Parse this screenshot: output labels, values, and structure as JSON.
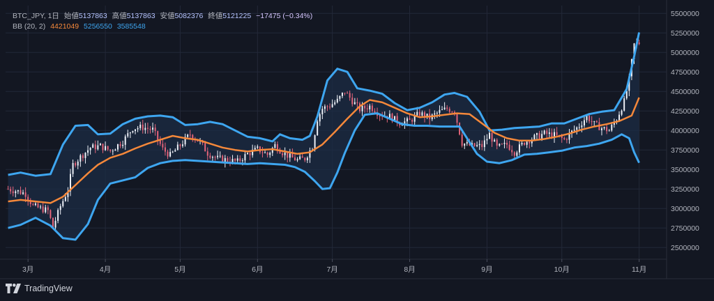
{
  "legend": {
    "symbol": "BTC_JPY, 1日",
    "open_label": "始値",
    "open": "5137863",
    "high_label": "高値",
    "high": "5137863",
    "low_label": "安値",
    "low": "5082376",
    "close_label": "終値",
    "close": "5121225",
    "change": "−17475 (−0.34%)",
    "bb_label": "BB (20, 2)",
    "bb_mid": "4421049",
    "bb_upper": "5256550",
    "bb_lower": "3585548"
  },
  "brand": {
    "text": "TradingView",
    "icon": "tradingview-logo-icon"
  },
  "colors": {
    "background": "#131722",
    "grid": "#232838",
    "band_fill": "#1c2c44",
    "upper_band": "#3ea6f0",
    "lower_band": "#3ea6f0",
    "middle_band": "#f5883a",
    "candle_up": "#f0f3fa",
    "candle_down": "#e8657b",
    "axis_text": "#b2b5be"
  },
  "chart_data": {
    "type": "candlestick",
    "xlabel": "",
    "ylabel": "",
    "x_ticks": [
      "3月",
      "4月",
      "5月",
      "6月",
      "7月",
      "8月",
      "9月",
      "10月",
      "11月"
    ],
    "y_ticks": [
      "2500000",
      "2750000",
      "3000000",
      "3250000",
      "3500000",
      "3750000",
      "4000000",
      "4250000",
      "4500000",
      "4750000",
      "5000000",
      "5250000",
      "5500000"
    ],
    "ylim": [
      2350000,
      5600000
    ],
    "x_range": [
      "2023-02-20",
      "2023-11-12"
    ],
    "grid": true,
    "upper_band": [
      [
        "2023-02-21",
        3430000
      ],
      [
        "2023-02-26",
        3460000
      ],
      [
        "2023-03-04",
        3420000
      ],
      [
        "2023-03-10",
        3440000
      ],
      [
        "2023-03-15",
        3820000
      ],
      [
        "2023-03-20",
        4060000
      ],
      [
        "2023-03-25",
        4070000
      ],
      [
        "2023-03-29",
        3950000
      ],
      [
        "2023-04-03",
        3960000
      ],
      [
        "2023-04-08",
        4080000
      ],
      [
        "2023-04-13",
        4150000
      ],
      [
        "2023-04-18",
        4180000
      ],
      [
        "2023-04-23",
        4190000
      ],
      [
        "2023-04-28",
        4170000
      ],
      [
        "2023-05-03",
        4070000
      ],
      [
        "2023-05-08",
        4080000
      ],
      [
        "2023-05-13",
        4110000
      ],
      [
        "2023-05-18",
        4080000
      ],
      [
        "2023-05-23",
        4000000
      ],
      [
        "2023-05-28",
        3920000
      ],
      [
        "2023-06-02",
        3900000
      ],
      [
        "2023-06-07",
        3860000
      ],
      [
        "2023-06-10",
        3950000
      ],
      [
        "2023-06-14",
        3900000
      ],
      [
        "2023-06-19",
        3880000
      ],
      [
        "2023-06-22",
        3930000
      ],
      [
        "2023-06-25",
        4180000
      ],
      [
        "2023-06-29",
        4640000
      ],
      [
        "2023-07-03",
        4790000
      ],
      [
        "2023-07-07",
        4750000
      ],
      [
        "2023-07-11",
        4540000
      ],
      [
        "2023-07-16",
        4510000
      ],
      [
        "2023-07-21",
        4470000
      ],
      [
        "2023-07-26",
        4350000
      ],
      [
        "2023-07-31",
        4260000
      ],
      [
        "2023-08-05",
        4290000
      ],
      [
        "2023-08-10",
        4360000
      ],
      [
        "2023-08-15",
        4460000
      ],
      [
        "2023-08-19",
        4480000
      ],
      [
        "2023-08-24",
        4430000
      ],
      [
        "2023-08-29",
        4240000
      ],
      [
        "2023-09-02",
        4000000
      ],
      [
        "2023-09-07",
        4010000
      ],
      [
        "2023-09-12",
        4030000
      ],
      [
        "2023-09-17",
        4040000
      ],
      [
        "2023-09-22",
        4050000
      ],
      [
        "2023-09-27",
        4090000
      ],
      [
        "2023-10-02",
        4090000
      ],
      [
        "2023-10-07",
        4150000
      ],
      [
        "2023-10-12",
        4210000
      ],
      [
        "2023-10-17",
        4240000
      ],
      [
        "2023-10-22",
        4260000
      ],
      [
        "2023-10-27",
        4530000
      ],
      [
        "2023-10-30",
        4950000
      ],
      [
        "2023-11-01",
        5256550
      ]
    ],
    "middle_band": [
      [
        "2023-02-21",
        3090000
      ],
      [
        "2023-02-26",
        3110000
      ],
      [
        "2023-03-04",
        3090000
      ],
      [
        "2023-03-10",
        3070000
      ],
      [
        "2023-03-15",
        3150000
      ],
      [
        "2023-03-20",
        3300000
      ],
      [
        "2023-03-25",
        3450000
      ],
      [
        "2023-03-29",
        3560000
      ],
      [
        "2023-04-03",
        3650000
      ],
      [
        "2023-04-08",
        3700000
      ],
      [
        "2023-04-13",
        3770000
      ],
      [
        "2023-04-18",
        3830000
      ],
      [
        "2023-04-23",
        3880000
      ],
      [
        "2023-04-28",
        3930000
      ],
      [
        "2023-05-03",
        3900000
      ],
      [
        "2023-05-08",
        3880000
      ],
      [
        "2023-05-13",
        3830000
      ],
      [
        "2023-05-18",
        3780000
      ],
      [
        "2023-05-23",
        3750000
      ],
      [
        "2023-05-28",
        3730000
      ],
      [
        "2023-06-02",
        3750000
      ],
      [
        "2023-06-07",
        3760000
      ],
      [
        "2023-06-12",
        3730000
      ],
      [
        "2023-06-17",
        3700000
      ],
      [
        "2023-06-22",
        3720000
      ],
      [
        "2023-06-27",
        3820000
      ],
      [
        "2023-07-02",
        3980000
      ],
      [
        "2023-07-07",
        4150000
      ],
      [
        "2023-07-12",
        4310000
      ],
      [
        "2023-07-16",
        4390000
      ],
      [
        "2023-07-21",
        4360000
      ],
      [
        "2023-07-26",
        4290000
      ],
      [
        "2023-07-31",
        4220000
      ],
      [
        "2023-08-05",
        4170000
      ],
      [
        "2023-08-10",
        4180000
      ],
      [
        "2023-08-15",
        4200000
      ],
      [
        "2023-08-20",
        4220000
      ],
      [
        "2023-08-25",
        4210000
      ],
      [
        "2023-08-30",
        4090000
      ],
      [
        "2023-09-04",
        3970000
      ],
      [
        "2023-09-09",
        3900000
      ],
      [
        "2023-09-14",
        3870000
      ],
      [
        "2023-09-19",
        3870000
      ],
      [
        "2023-09-24",
        3890000
      ],
      [
        "2023-09-29",
        3920000
      ],
      [
        "2023-10-04",
        3960000
      ],
      [
        "2023-10-09",
        4010000
      ],
      [
        "2023-10-14",
        4050000
      ],
      [
        "2023-10-19",
        4080000
      ],
      [
        "2023-10-24",
        4120000
      ],
      [
        "2023-10-29",
        4190000
      ],
      [
        "2023-11-01",
        4421049
      ]
    ],
    "lower_band": [
      [
        "2023-02-21",
        2750000
      ],
      [
        "2023-02-26",
        2790000
      ],
      [
        "2023-03-04",
        2880000
      ],
      [
        "2023-03-10",
        2780000
      ],
      [
        "2023-03-15",
        2620000
      ],
      [
        "2023-03-20",
        2600000
      ],
      [
        "2023-03-25",
        2800000
      ],
      [
        "2023-03-29",
        3110000
      ],
      [
        "2023-04-03",
        3320000
      ],
      [
        "2023-04-08",
        3360000
      ],
      [
        "2023-04-13",
        3400000
      ],
      [
        "2023-04-18",
        3520000
      ],
      [
        "2023-04-23",
        3580000
      ],
      [
        "2023-04-28",
        3610000
      ],
      [
        "2023-05-03",
        3620000
      ],
      [
        "2023-05-08",
        3610000
      ],
      [
        "2023-05-13",
        3600000
      ],
      [
        "2023-05-18",
        3590000
      ],
      [
        "2023-05-23",
        3580000
      ],
      [
        "2023-05-28",
        3570000
      ],
      [
        "2023-06-02",
        3580000
      ],
      [
        "2023-06-07",
        3570000
      ],
      [
        "2023-06-12",
        3560000
      ],
      [
        "2023-06-16",
        3530000
      ],
      [
        "2023-06-20",
        3470000
      ],
      [
        "2023-06-24",
        3350000
      ],
      [
        "2023-06-27",
        3250000
      ],
      [
        "2023-06-30",
        3260000
      ],
      [
        "2023-07-03",
        3460000
      ],
      [
        "2023-07-06",
        3710000
      ],
      [
        "2023-07-10",
        4000000
      ],
      [
        "2023-07-14",
        4200000
      ],
      [
        "2023-07-19",
        4220000
      ],
      [
        "2023-07-24",
        4150000
      ],
      [
        "2023-07-29",
        4080000
      ],
      [
        "2023-08-03",
        4060000
      ],
      [
        "2023-08-08",
        4060000
      ],
      [
        "2023-08-13",
        4050000
      ],
      [
        "2023-08-18",
        4050000
      ],
      [
        "2023-08-21",
        4050000
      ],
      [
        "2023-08-24",
        3900000
      ],
      [
        "2023-08-28",
        3700000
      ],
      [
        "2023-09-01",
        3600000
      ],
      [
        "2023-09-06",
        3580000
      ],
      [
        "2023-09-11",
        3620000
      ],
      [
        "2023-09-16",
        3690000
      ],
      [
        "2023-09-21",
        3700000
      ],
      [
        "2023-09-26",
        3720000
      ],
      [
        "2023-10-01",
        3740000
      ],
      [
        "2023-10-06",
        3780000
      ],
      [
        "2023-10-11",
        3800000
      ],
      [
        "2023-10-16",
        3830000
      ],
      [
        "2023-10-21",
        3880000
      ],
      [
        "2023-10-25",
        3950000
      ],
      [
        "2023-10-28",
        3900000
      ],
      [
        "2023-10-30",
        3720000
      ],
      [
        "2023-11-01",
        3585548
      ]
    ],
    "close_path": [
      [
        "2023-02-21",
        3250000
      ],
      [
        "2023-02-25",
        3220000
      ],
      [
        "2023-02-28",
        3190000
      ],
      [
        "2023-03-03",
        3030000
      ],
      [
        "2023-03-06",
        3000000
      ],
      [
        "2023-03-09",
        2970000
      ],
      [
        "2023-03-11",
        2760000
      ],
      [
        "2023-03-14",
        3030000
      ],
      [
        "2023-03-17",
        3240000
      ],
      [
        "2023-03-19",
        3560000
      ],
      [
        "2023-03-22",
        3660000
      ],
      [
        "2023-03-26",
        3780000
      ],
      [
        "2023-03-30",
        3800000
      ],
      [
        "2023-04-03",
        3740000
      ],
      [
        "2023-04-08",
        3860000
      ],
      [
        "2023-04-12",
        4030000
      ],
      [
        "2023-04-16",
        4040000
      ],
      [
        "2023-04-20",
        4010000
      ],
      [
        "2023-04-24",
        3760000
      ],
      [
        "2023-04-27",
        3680000
      ],
      [
        "2023-05-01",
        3810000
      ],
      [
        "2023-05-05",
        3950000
      ],
      [
        "2023-05-09",
        3850000
      ],
      [
        "2023-05-12",
        3710000
      ],
      [
        "2023-05-16",
        3640000
      ],
      [
        "2023-05-20",
        3620000
      ],
      [
        "2023-05-24",
        3600000
      ],
      [
        "2023-05-28",
        3700000
      ],
      [
        "2023-06-01",
        3760000
      ],
      [
        "2023-06-05",
        3690000
      ],
      [
        "2023-06-08",
        3810000
      ],
      [
        "2023-06-11",
        3720000
      ],
      [
        "2023-06-14",
        3660000
      ],
      [
        "2023-06-17",
        3620000
      ],
      [
        "2023-06-20",
        3640000
      ],
      [
        "2023-06-23",
        3790000
      ],
      [
        "2023-06-25",
        4150000
      ],
      [
        "2023-06-27",
        4280000
      ],
      [
        "2023-06-30",
        4320000
      ],
      [
        "2023-07-03",
        4380000
      ],
      [
        "2023-07-06",
        4500000
      ],
      [
        "2023-07-09",
        4380000
      ],
      [
        "2023-07-12",
        4270000
      ],
      [
        "2023-07-16",
        4310000
      ],
      [
        "2023-07-20",
        4210000
      ],
      [
        "2023-07-24",
        4180000
      ],
      [
        "2023-07-28",
        4100000
      ],
      [
        "2023-08-01",
        4120000
      ],
      [
        "2023-08-05",
        4220000
      ],
      [
        "2023-08-09",
        4160000
      ],
      [
        "2023-08-13",
        4240000
      ],
      [
        "2023-08-16",
        4280000
      ],
      [
        "2023-08-19",
        4250000
      ],
      [
        "2023-08-22",
        3840000
      ],
      [
        "2023-08-26",
        3800000
      ],
      [
        "2023-08-30",
        3800000
      ],
      [
        "2023-09-02",
        3950000
      ],
      [
        "2023-09-05",
        3780000
      ],
      [
        "2023-09-09",
        3820000
      ],
      [
        "2023-09-12",
        3720000
      ],
      [
        "2023-09-16",
        3850000
      ],
      [
        "2023-09-20",
        3910000
      ],
      [
        "2023-09-24",
        3960000
      ],
      [
        "2023-09-28",
        3940000
      ],
      [
        "2023-10-02",
        3880000
      ],
      [
        "2023-10-05",
        3980000
      ],
      [
        "2023-10-08",
        4060000
      ],
      [
        "2023-10-11",
        4180000
      ],
      [
        "2023-10-14",
        4080000
      ],
      [
        "2023-10-17",
        4030000
      ],
      [
        "2023-10-20",
        4000000
      ],
      [
        "2023-10-23",
        4150000
      ],
      [
        "2023-10-26",
        4370000
      ],
      [
        "2023-10-28",
        4650000
      ],
      [
        "2023-10-30",
        5100000
      ],
      [
        "2023-11-01",
        5121225
      ]
    ],
    "last_candle": {
      "open": 5137863,
      "high": 5137863,
      "low": 5082376,
      "close": 5121225
    }
  }
}
